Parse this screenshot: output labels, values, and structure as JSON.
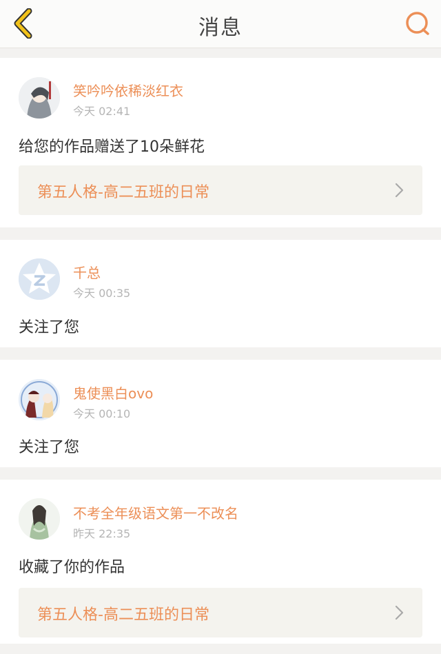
{
  "header": {
    "title": "消息"
  },
  "colors": {
    "accent": "#ec8f57",
    "link_bg": "#f4f3ee",
    "page_bg": "#f3f2f0"
  },
  "notifications": [
    {
      "user": "笑吟吟依稀淡红衣",
      "time": "今天 02:41",
      "action": "给您的作品赠送了10朵鲜花",
      "work_title": "第五人格-高二五班的日常",
      "avatar_icon": "anime-character-avatar"
    },
    {
      "user": "千总",
      "time": "今天 00:35",
      "action": "关注了您",
      "avatar_icon": "qq-default-avatar"
    },
    {
      "user": "鬼使黑白ovo",
      "time": "今天 00:10",
      "action": "关注了您",
      "avatar_icon": "anime-character-avatar"
    },
    {
      "user": "不考全年级语文第一不改名",
      "time": "昨天 22:35",
      "action": "收藏了你的作品",
      "work_title": "第五人格-高二五班的日常",
      "avatar_icon": "anime-character-avatar"
    }
  ]
}
